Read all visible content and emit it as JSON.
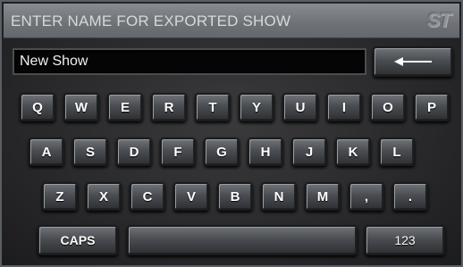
{
  "dialog": {
    "title": "ENTER NAME FOR EXPORTED SHOW",
    "logo_text": "ST"
  },
  "input": {
    "value": "New Show"
  },
  "keyboard": {
    "row1": [
      "Q",
      "W",
      "E",
      "R",
      "T",
      "Y",
      "U",
      "I",
      "O",
      "P"
    ],
    "row2": [
      "A",
      "S",
      "D",
      "F",
      "G",
      "H",
      "J",
      "K",
      "L"
    ],
    "row3": [
      "Z",
      "X",
      "C",
      "V",
      "B",
      "N",
      "M",
      ",",
      "."
    ],
    "caps_label": "CAPS",
    "numbers_label": "123",
    "backspace_icon": "left-arrow-icon"
  }
}
